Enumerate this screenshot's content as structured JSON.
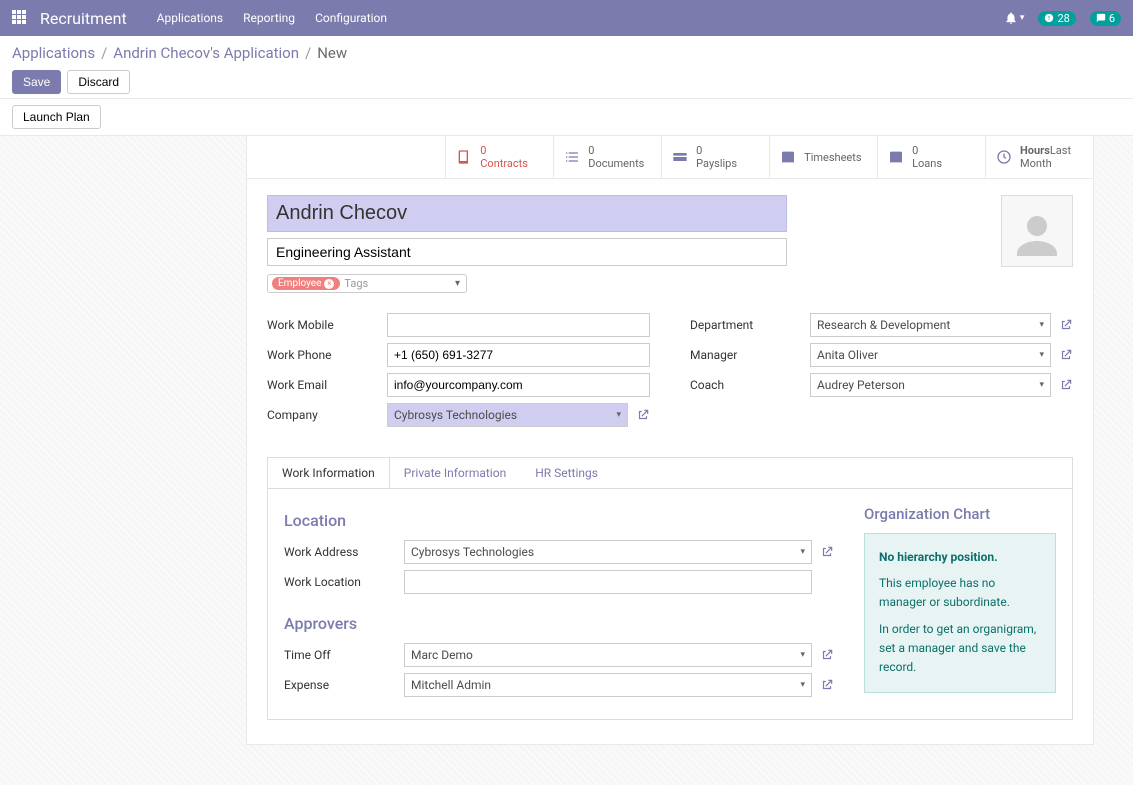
{
  "topbar": {
    "brand": "Recruitment",
    "menu": [
      "Applications",
      "Reporting",
      "Configuration"
    ],
    "clock_badge": "28",
    "chat_badge": "6"
  },
  "breadcrumb": {
    "items": [
      "Applications",
      "Andrin Checov's Application"
    ],
    "current": "New"
  },
  "buttons": {
    "save": "Save",
    "discard": "Discard",
    "launch_plan": "Launch Plan"
  },
  "statbar": {
    "contracts": {
      "num": "0",
      "label": "Contracts"
    },
    "documents": {
      "num": "0",
      "label": "Documents"
    },
    "payslips": {
      "num": "0",
      "label": "Payslips"
    },
    "timesheets": {
      "label": "Timesheets"
    },
    "loans": {
      "num": "0",
      "label": "Loans"
    },
    "hours": {
      "label": "Hours",
      "sub": "Last Month"
    }
  },
  "employee": {
    "name": "Andrin Checov",
    "title": "Engineering Assistant",
    "tag": "Employee",
    "tags_placeholder": "Tags"
  },
  "fields": {
    "left": {
      "work_mobile_label": "Work Mobile",
      "work_mobile": "",
      "work_phone_label": "Work Phone",
      "work_phone": "+1 (650) 691-3277",
      "work_email_label": "Work Email",
      "work_email": "info@yourcompany.com",
      "company_label": "Company",
      "company": "Cybrosys Technologies"
    },
    "right": {
      "department_label": "Department",
      "department": "Research & Development",
      "manager_label": "Manager",
      "manager": "Anita Oliver",
      "coach_label": "Coach",
      "coach": "Audrey Peterson"
    }
  },
  "tabs": {
    "work_info": "Work Information",
    "private_info": "Private Information",
    "hr_settings": "HR Settings"
  },
  "work_info": {
    "location_title": "Location",
    "work_address_label": "Work Address",
    "work_address": "Cybrosys Technologies",
    "work_location_label": "Work Location",
    "work_location": "",
    "approvers_title": "Approvers",
    "time_off_label": "Time Off",
    "time_off": "Marc Demo",
    "expense_label": "Expense",
    "expense": "Mitchell Admin",
    "org_title": "Organization Chart",
    "org_heading": "No hierarchy position.",
    "org_line1": "This employee has no manager or subordinate.",
    "org_line2": "In order to get an organigram, set a manager and save the record."
  }
}
